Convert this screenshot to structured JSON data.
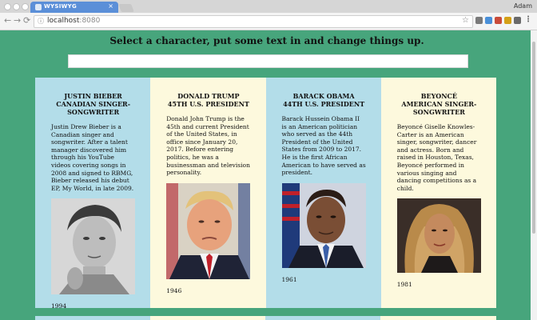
{
  "browser": {
    "tab_title": "WYSIWYG",
    "tab_close": "×",
    "user_name": "Adam",
    "url_host": "localhost",
    "url_port": ":8080",
    "back": "←",
    "forward": "→",
    "reload": "⟳",
    "star": "☆",
    "menu": "⋮"
  },
  "page": {
    "heading": "Select a character, put some text in and change things up.",
    "text_input_value": ""
  },
  "cards": [
    {
      "name": "JUSTIN BIEBER",
      "role": "CANADIAN SINGER-SONGWRITER",
      "bio": "Justin Drew Bieber is a Canadian singer and songwriter. After a talent manager discovered him through his YouTube videos covering songs in 2008 and signed to RBMG, Bieber released his debut EP, My World, in late 2009.",
      "year": "1994"
    },
    {
      "name": "DONALD TRUMP",
      "role": "45TH U.S. PRESIDENT",
      "bio": "Donald John Trump is the 45th and current President of the United States, in office since January 20, 2017. Before entering politics, he was a businessman and television personality.",
      "year": "1946"
    },
    {
      "name": "BARACK OBAMA",
      "role": "44TH U.S. PRESIDENT",
      "bio": "Barack Hussein Obama II is an American politician who served as the 44th President of the United States from 2009 to 2017. He is the first African American to have served as president.",
      "year": "1961"
    },
    {
      "name": "BEYONCÉ",
      "role": "AMERICAN SINGER-SONGWRITER",
      "bio": "Beyoncé Giselle Knowles-Carter is an American singer, songwriter, dancer and actress. Born and raised in Houston, Texas, Beyoncé performed in various singing and dancing competitions as a child.",
      "year": "1981"
    }
  ],
  "colors": {
    "background": "#47a57c",
    "card_blue": "#b3dde9",
    "card_cream": "#fdf9dd",
    "tab": "#5b8fd8"
  }
}
